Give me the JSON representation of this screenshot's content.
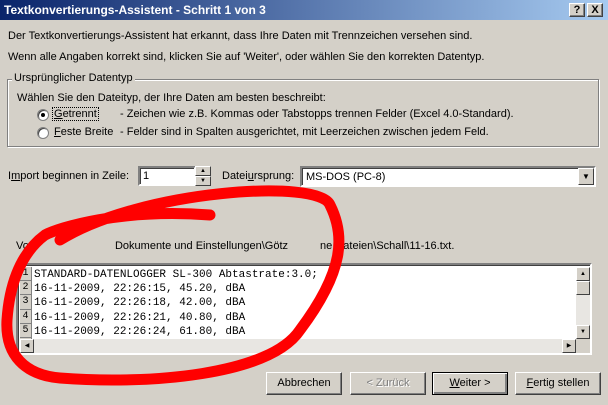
{
  "window": {
    "title": "Textkonvertierungs-Assistent - Schritt 1 von 3",
    "help_label": "?",
    "close_label": "X"
  },
  "intro": {
    "line1": "Der Textkonvertierungs-Assistent hat erkannt, dass Ihre Daten mit Trennzeichen versehen sind.",
    "line2": "Wenn alle Angaben korrekt sind, klicken Sie auf 'Weiter', oder wählen Sie den korrekten Datentyp."
  },
  "datatype_group": {
    "label": "Ursprünglicher Datentyp",
    "prompt": "Wählen Sie den Dateityp, der Ihre Daten am besten beschreibt:",
    "options": [
      {
        "hotkey": "G",
        "rest": "etrennt",
        "description": "- Zeichen wie z.B. Kommas oder Tabstopps trennen Felder (Excel 4.0-Standard).",
        "checked": true
      },
      {
        "hotkey": "F",
        "rest": "este Breite",
        "description": "- Felder sind in Spalten ausgerichtet, mit Leerzeichen zwischen jedem Feld.",
        "checked": false
      }
    ]
  },
  "import_row": {
    "label_pre": "I",
    "label_hot": "m",
    "label_post": "port beginnen in Zeile:",
    "value": "1"
  },
  "origin": {
    "label_pre": "Datei",
    "label_hot": "u",
    "label_post": "rsprung:",
    "value": "MS-DOS (PC-8)"
  },
  "preview": {
    "caption_visible": "Dokumente und Einstellungen\\Götz",
    "caption_end": "Dateien\\Schall\\11-16.txt.",
    "caption_fragment_a": "Vo",
    "caption_fragment_b": "ne",
    "line_numbers": [
      "1",
      "2",
      "3",
      "4",
      "5"
    ],
    "lines": [
      "STANDARD-DATENLOGGER SL-300 Abtastrate:3.0;",
      "16-11-2009, 22:26:15, 45.20, dBA",
      "16-11-2009, 22:26:18, 42.00, dBA",
      "16-11-2009, 22:26:21, 40.80, dBA",
      "16-11-2009, 22:26:24, 61.80, dBA"
    ]
  },
  "buttons": {
    "cancel": "Abbrechen",
    "back": "< Zurück",
    "next_hot": "W",
    "next_rest": "eiter >",
    "finish_hot": "F",
    "finish_rest": "ertig stellen"
  },
  "annotation_color": "#ff0000"
}
